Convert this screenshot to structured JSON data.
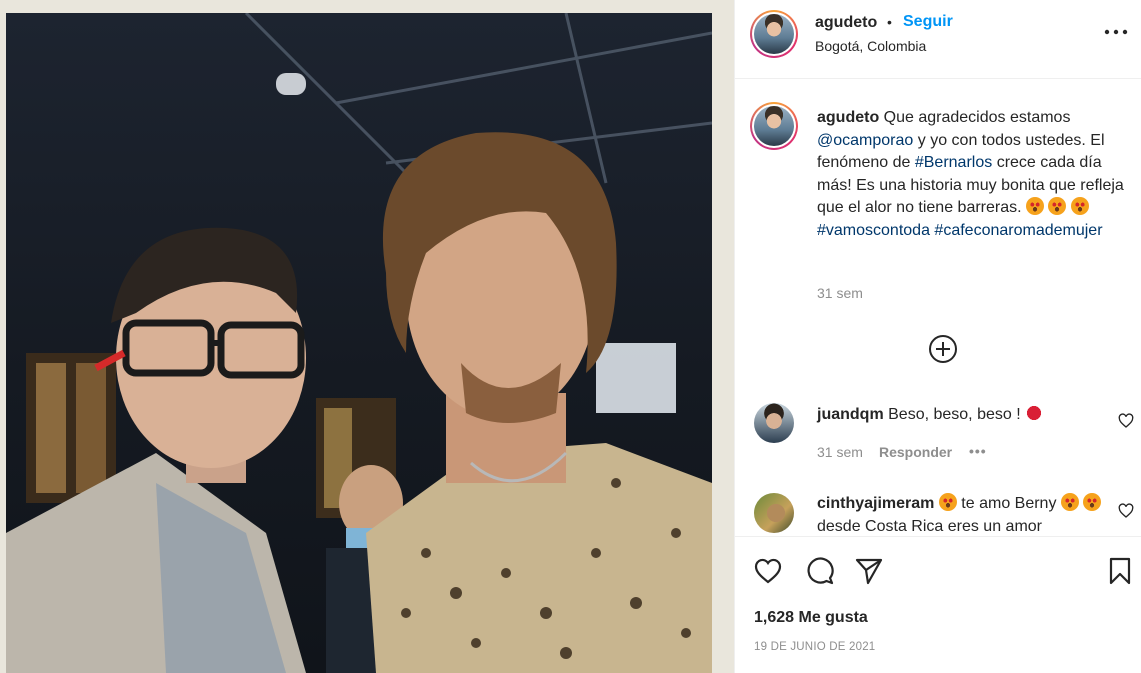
{
  "post": {
    "username": "agudeto",
    "dot": "•",
    "follow_label": "Seguir",
    "location": "Bogotá, Colombia"
  },
  "caption": {
    "username": "agudeto",
    "text_1": "Que agradecidos estamos",
    "mention": "@ocamporao",
    "text_2": "y yo con todos ustedes. El fenómeno de",
    "hashtag_1": "#Bernarlos",
    "text_3": "crece cada día más! Es una historia muy bonita que refleja que el alor no tiene barreras.",
    "hashtag_2": "#vamoscontoda",
    "hashtag_3": "#cafeconaromademujer",
    "time": "31 sem"
  },
  "comments": [
    {
      "username": "juandqm",
      "text": "Beso, beso, beso !",
      "time": "31 sem",
      "reply_label": "Responder",
      "more": "•••"
    },
    {
      "username": "cinthyajimeram",
      "text_1": "te amo Berny",
      "text_2": "desde Costa Rica eres un amor"
    }
  ],
  "stats": {
    "likes": "1,628 Me gusta",
    "date": "19 DE JUNIO DE 2021"
  },
  "icons": {
    "more": "more-horizontal-icon",
    "load_more": "plus-circle-icon",
    "like": "heart-icon",
    "comment": "comment-icon",
    "share": "paper-plane-icon",
    "save": "bookmark-icon"
  },
  "colors": {
    "link_blue": "#0095f6",
    "hashtag_blue": "#00376b",
    "muted": "#8e8e8e",
    "text": "#262626"
  }
}
